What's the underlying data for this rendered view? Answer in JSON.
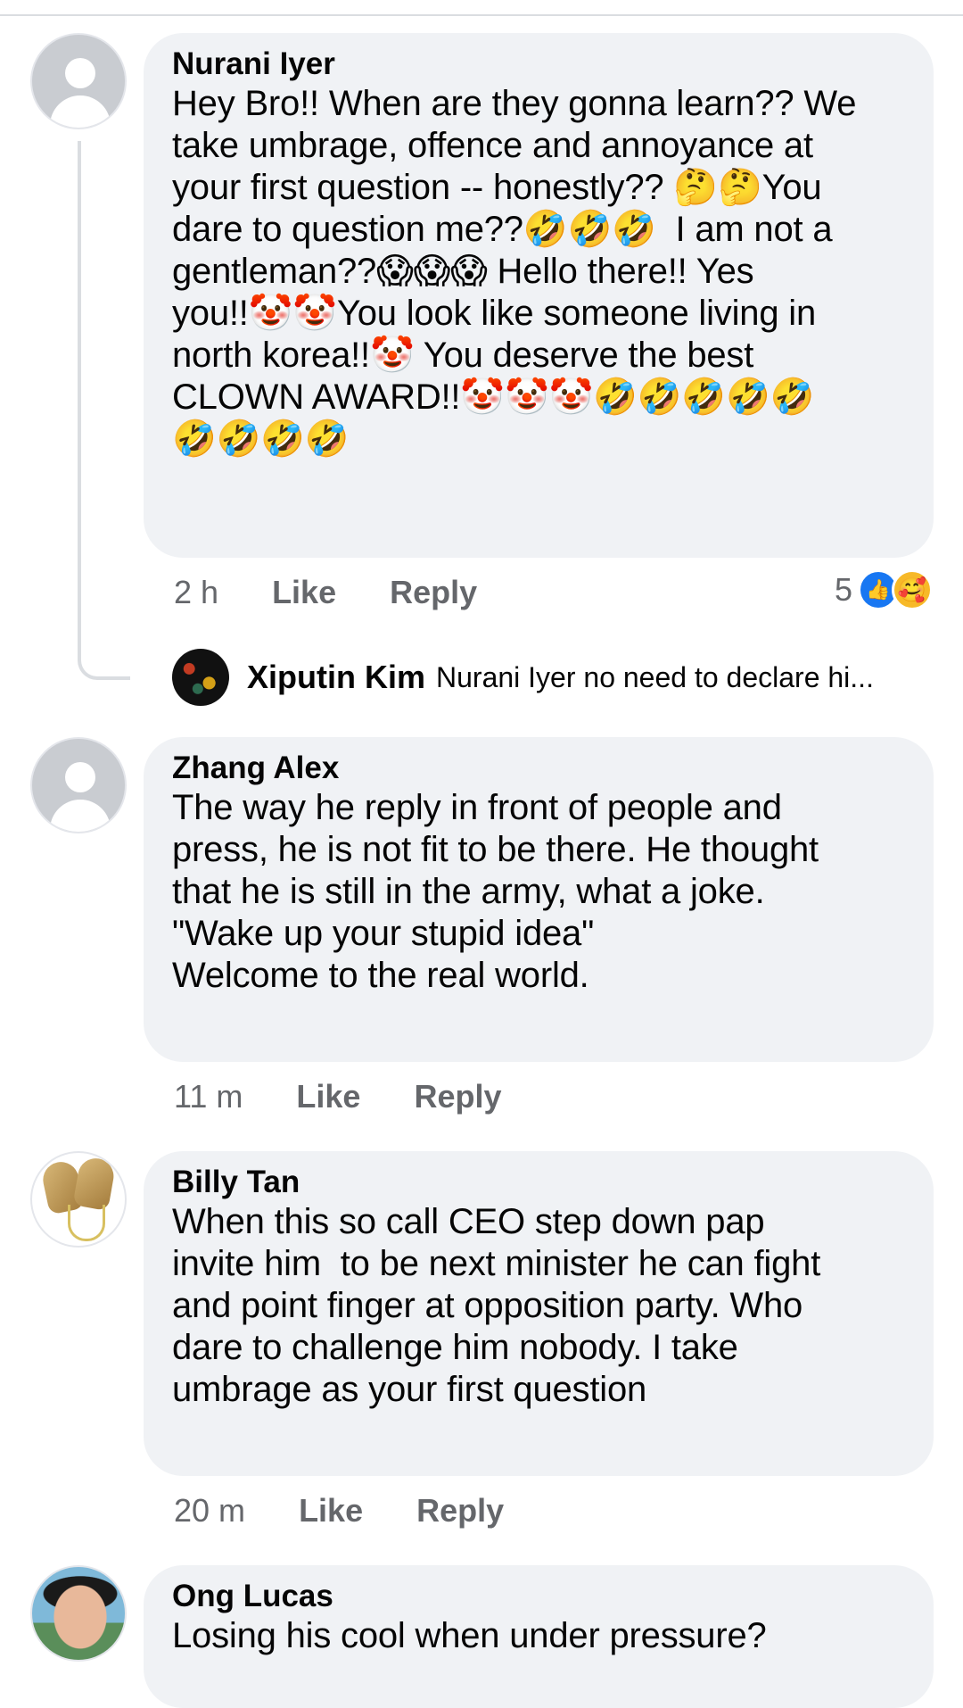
{
  "comments": [
    {
      "author": "Nurani Iyer",
      "text_lines": [
        "Hey Bro!! When are they gonna learn?? We",
        "take umbrage, offence and annoyance at",
        "your first question -- honestly?? 🤔🤔You",
        "dare to question me??🤣🤣🤣  I am not a",
        "gentleman??😱😱😱 Hello there!! Yes",
        "you!!🤡🤡You look like someone living in",
        "north korea!!🤡 You deserve the best",
        "CLOWN AWARD!!🤡🤡🤡🤣🤣🤣🤣🤣",
        "🤣🤣🤣🤣"
      ],
      "time": "2 h",
      "like_label": "Like",
      "reply_label": "Reply",
      "reaction_count": "5",
      "reaction_icons": [
        "like-icon",
        "care-icon"
      ],
      "reply_preview": {
        "author": "Xiputin Kim",
        "snippet": "Nurani Iyer no need to declare hi..."
      }
    },
    {
      "author": "Zhang Alex",
      "text_lines": [
        "The way he reply in front of people and",
        "press, he is not fit to be there. He thought",
        "that he is still in the army, what a joke.",
        "\"Wake up your stupid idea\"",
        "Welcome to the real world."
      ],
      "time": "11 m",
      "like_label": "Like",
      "reply_label": "Reply"
    },
    {
      "author": "Billy Tan",
      "text_lines": [
        "When this so call CEO step down pap",
        "invite him  to be next minister he can fight",
        "and point finger at opposition party. Who",
        "dare to challenge him nobody. I take",
        "umbrage as your first question"
      ],
      "time": "20 m",
      "like_label": "Like",
      "reply_label": "Reply"
    },
    {
      "author": "Ong Lucas",
      "text_lines": [
        "Losing his cool when under pressure?"
      ]
    }
  ],
  "colors": {
    "bubble": "#f0f2f5",
    "meta_text": "#65676b",
    "like_blue": "#1877f2"
  }
}
